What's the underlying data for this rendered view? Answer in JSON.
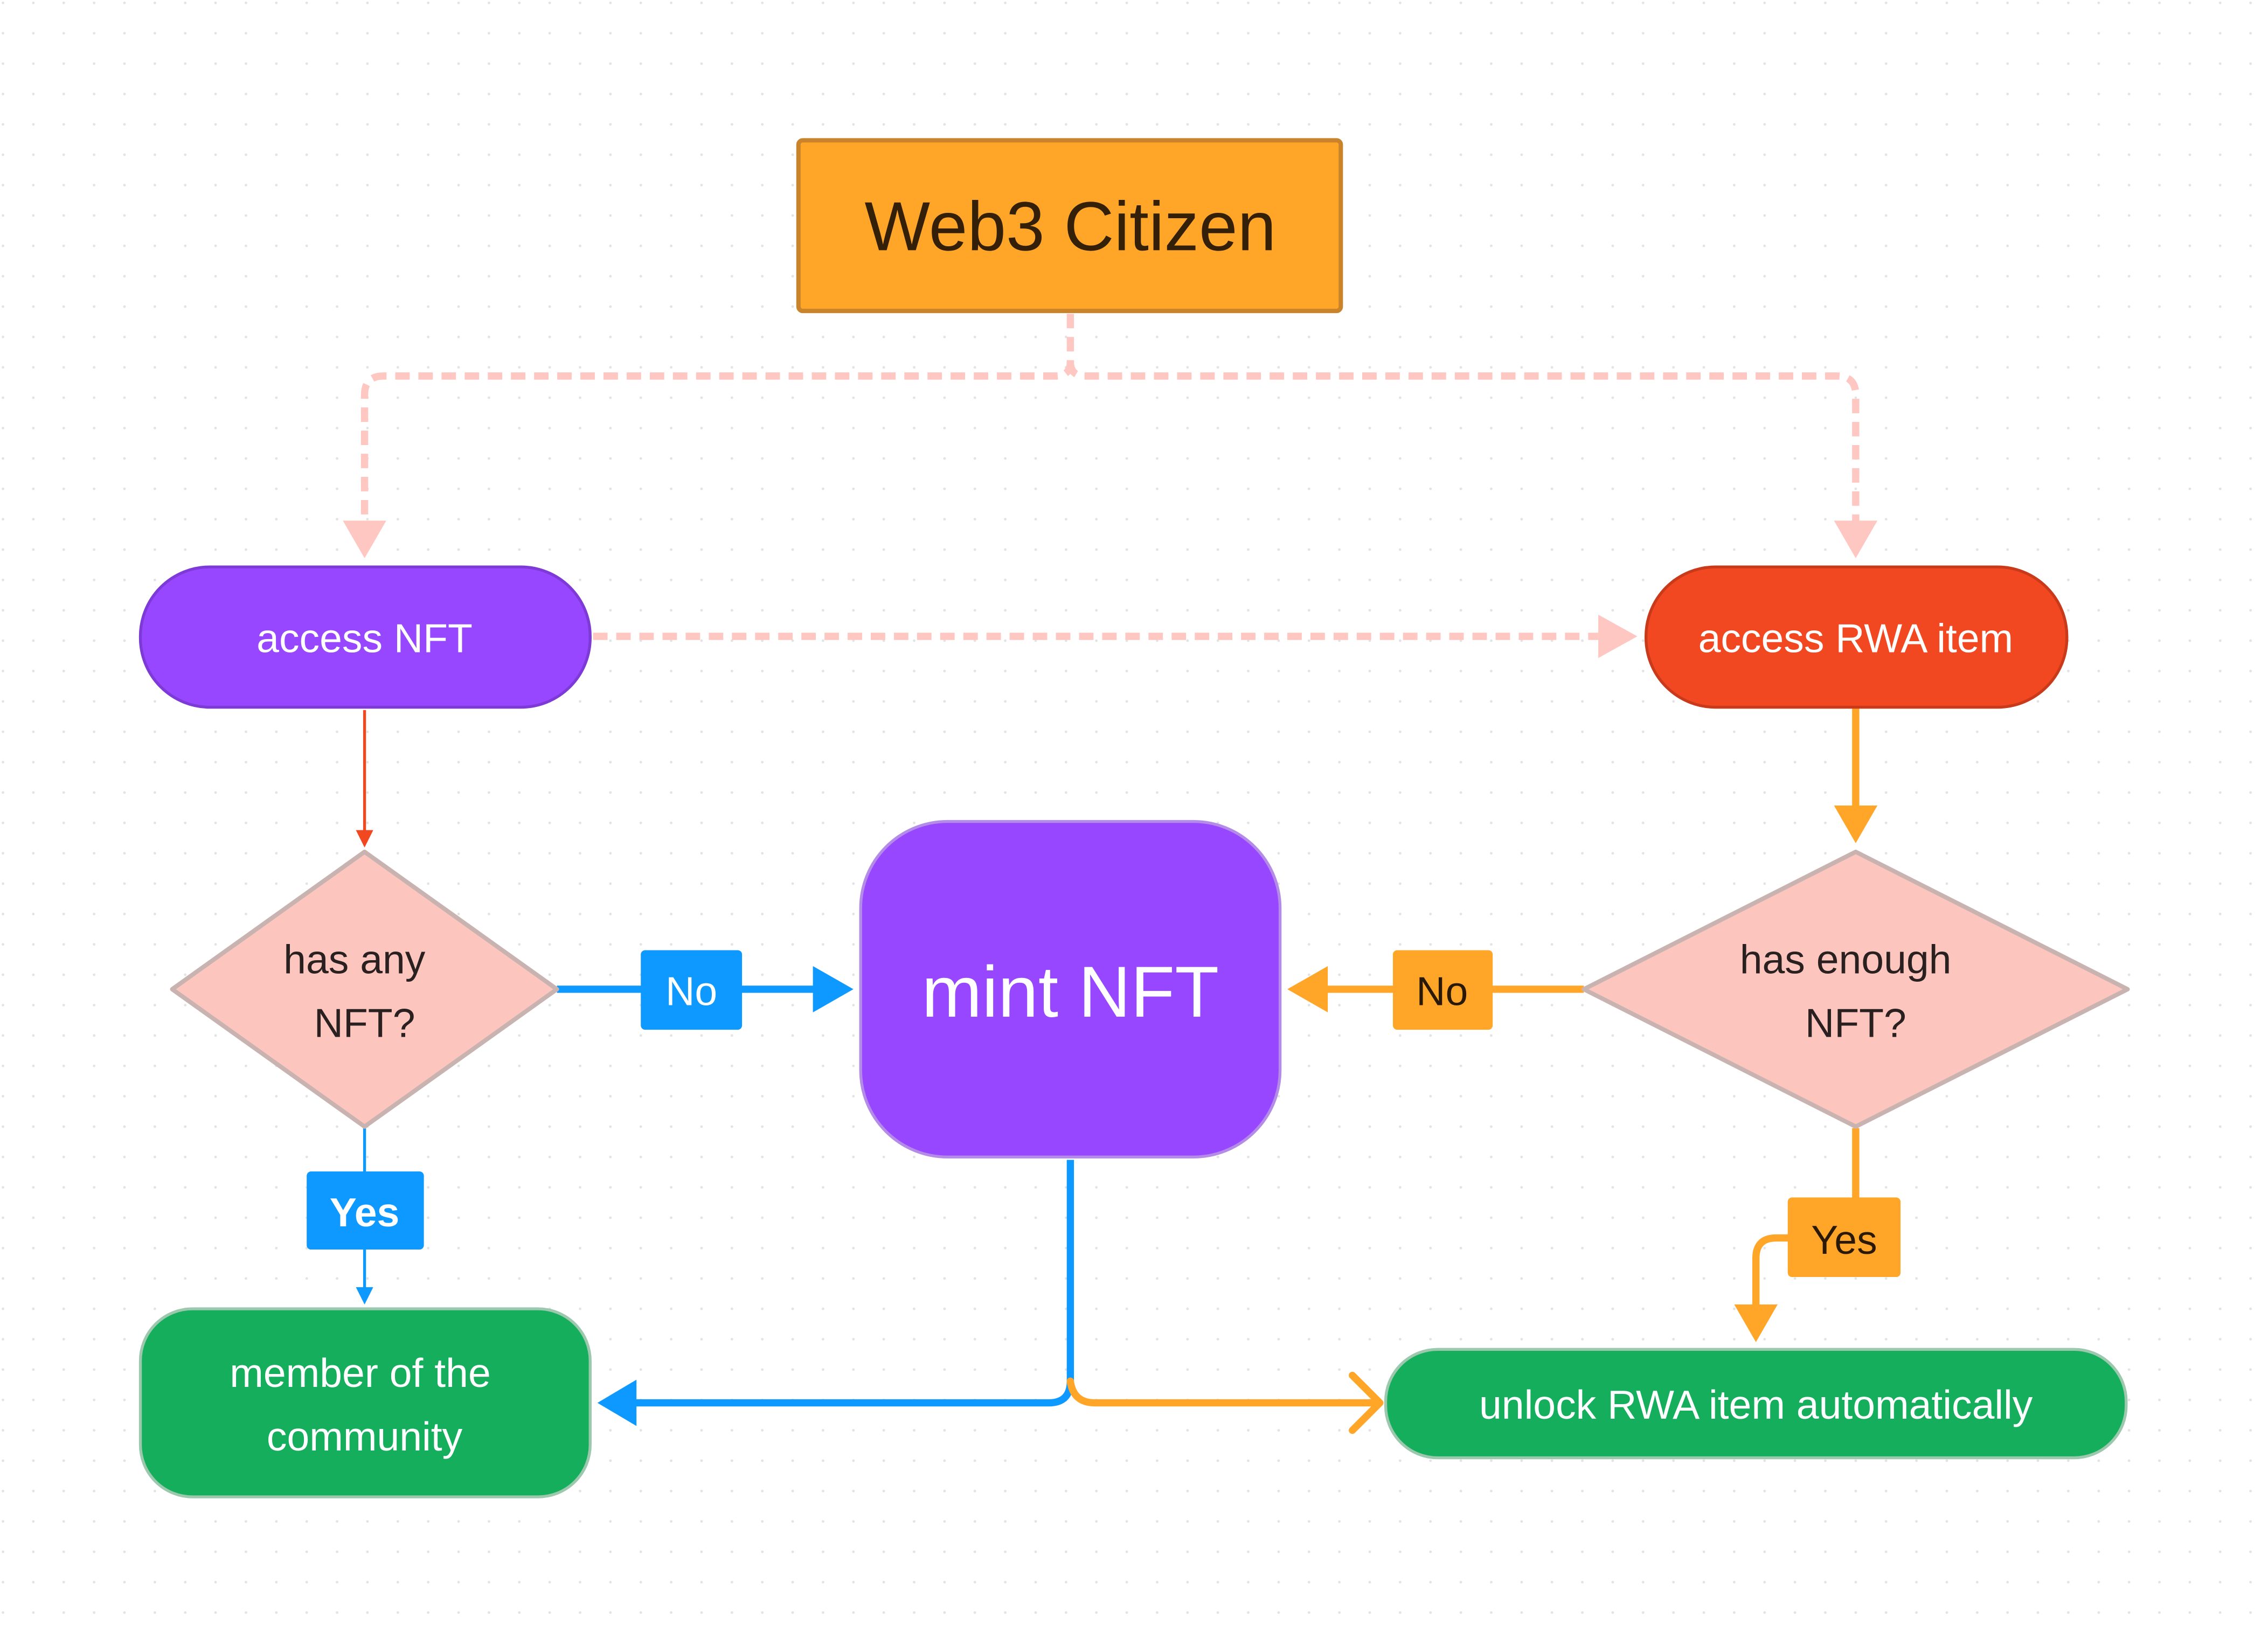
{
  "nodes": {
    "web3_citizen": "Web3 Citizen",
    "access_nft": "access NFT",
    "access_rwa": "access RWA item",
    "has_any_nft": [
      "has any",
      "NFT?"
    ],
    "mint_nft": "mint NFT",
    "has_enough_nft": [
      "has enough",
      "NFT?"
    ],
    "member": [
      "member of the",
      "community"
    ],
    "unlock_rwa": "unlock RWA item automatically"
  },
  "edge_labels": {
    "left_no": "No",
    "left_yes": "Yes",
    "right_no": "No",
    "right_yes": "Yes"
  },
  "colors": {
    "orange": "#FFA629",
    "purple": "#9747FF",
    "red": "#F24822",
    "pink": "#FCC6BF",
    "dashed_pink": "#FFC7C2",
    "blue": "#0D99FF",
    "green": "#14AE5C"
  }
}
